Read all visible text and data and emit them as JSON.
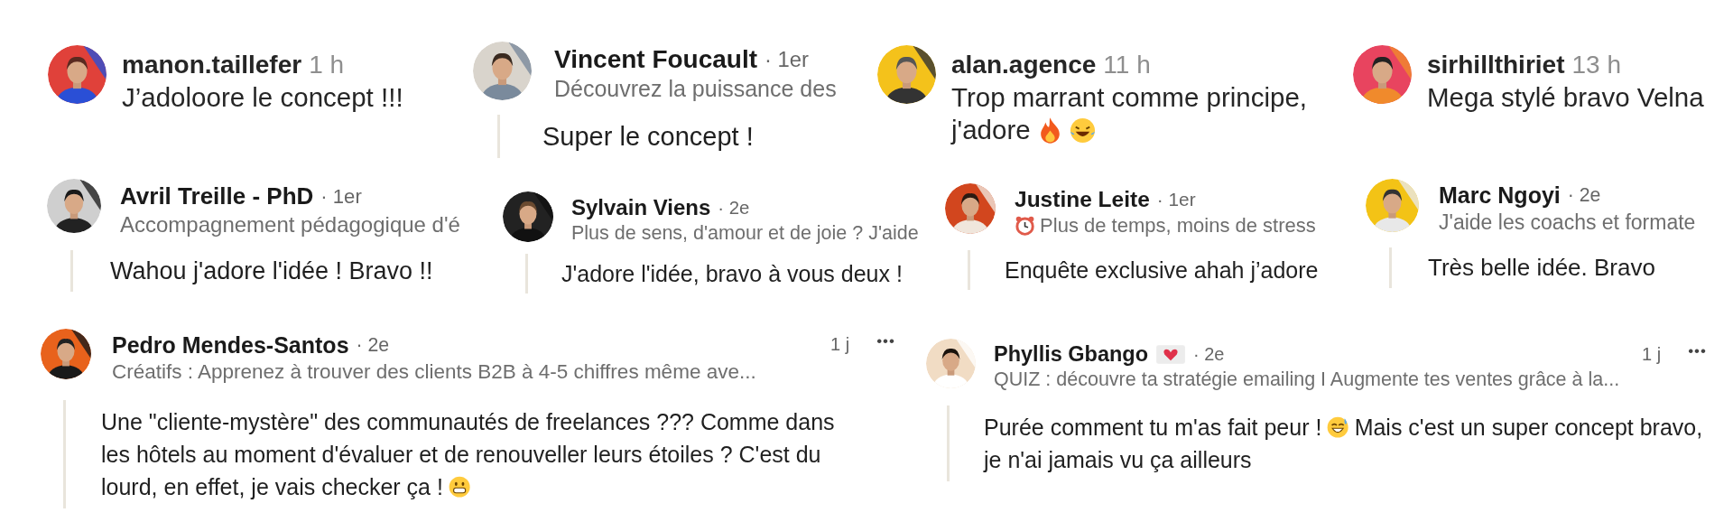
{
  "rows": [
    {
      "comments": [
        {
          "kind": "instagram",
          "author": "manon.taillefer",
          "time": "1 h",
          "text": [
            [
              {
                "kind": "text",
                "text": "J’adoloore le concept !!!"
              }
            ]
          ]
        },
        {
          "kind": "linkedin",
          "author": "Vincent Foucault",
          "degree": "· 1er",
          "headline": [
            {
              "kind": "text",
              "text": "Découvrez la puissance des"
            }
          ],
          "text": [
            [
              {
                "kind": "text",
                "text": "Super le concept !"
              }
            ]
          ]
        },
        {
          "kind": "instagram",
          "author": "alan.agence",
          "time": "11 h",
          "text": [
            [
              {
                "kind": "text",
                "text": "Trop marrant comme principe,"
              }
            ],
            [
              {
                "kind": "text",
                "text": "j'adore"
              },
              {
                "kind": "flame"
              },
              {
                "kind": "laugh"
              }
            ]
          ]
        },
        {
          "kind": "instagram",
          "author": "sirhillthiriet",
          "time": "13 h",
          "text": [
            [
              {
                "kind": "text",
                "text": "Mega stylé bravo Velna"
              }
            ]
          ]
        }
      ]
    },
    {
      "comments": [
        {
          "kind": "linkedin",
          "author": "Avril Treille - PhD",
          "degree": "· 1er",
          "headline": [
            {
              "kind": "text",
              "text": "Accompagnement pédagogique d'é"
            }
          ],
          "text": [
            [
              {
                "kind": "text",
                "text": "Wahou j'adore l'idée ! Bravo !!"
              }
            ]
          ]
        },
        {
          "kind": "linkedin",
          "author": "Sylvain Viens",
          "degree": "· 2e",
          "headline": [
            {
              "kind": "text",
              "text": "Plus de sens, d'amour et de joie ? J'aide"
            }
          ],
          "text": [
            [
              {
                "kind": "text",
                "text": "J'adore l'idée, bravo à vous deux !"
              }
            ]
          ]
        },
        {
          "kind": "linkedin",
          "author": "Justine Leite",
          "degree": "· 1er",
          "headline": [
            {
              "kind": "clock"
            },
            {
              "kind": "text",
              "text": "Plus de temps, moins de stress"
            }
          ],
          "text": [
            [
              {
                "kind": "text",
                "text": "Enquête exclusive ahah j’adore"
              }
            ]
          ]
        },
        {
          "kind": "linkedin",
          "author": "Marc Ngoyi",
          "degree": "· 2e",
          "headline": [
            {
              "kind": "text",
              "text": "J'aide les coachs et formate"
            }
          ],
          "text": [
            [
              {
                "kind": "text",
                "text": "Très belle idée. Bravo"
              }
            ]
          ]
        }
      ]
    },
    {
      "comments": [
        {
          "kind": "linkedin",
          "author": "Pedro Mendes-Santos",
          "degree": "· 2e",
          "time": "1 j",
          "more": "•••",
          "headline": [
            {
              "kind": "text",
              "text": "Créatifs : Apprenez à trouver des clients B2B à 4-5 chiffres même ave..."
            }
          ],
          "text": [
            [
              {
                "kind": "text",
                "text": "Une \"cliente-mystère\" des communautés de freelances ??? Comme dans"
              }
            ],
            [
              {
                "kind": "text",
                "text": "les hôtels au moment d'évaluer et de renouveller leurs étoiles ? C'est du"
              }
            ],
            [
              {
                "kind": "text",
                "text": "lourd, en effet, je vais checker ça !"
              },
              {
                "kind": "grin"
              }
            ]
          ]
        },
        {
          "kind": "linkedin",
          "author": "Phyllis Gbango",
          "badge": {
            "kind": "heart"
          },
          "degree": "· 2e",
          "time": "1 j",
          "more": "•••",
          "headline": [
            {
              "kind": "text",
              "text": "QUIZ : découvre ta stratégie emailing I Augmente tes ventes grâce à la..."
            }
          ],
          "text": [
            [
              {
                "kind": "text",
                "text": "Purée comment tu m'as fait peur !"
              },
              {
                "kind": "sweat"
              },
              {
                "kind": "text",
                "text": "Mais c'est un super concept bravo,"
              }
            ],
            [
              {
                "kind": "text",
                "text": "je n'ai jamais vu ça ailleurs"
              }
            ]
          ]
        }
      ]
    }
  ]
}
